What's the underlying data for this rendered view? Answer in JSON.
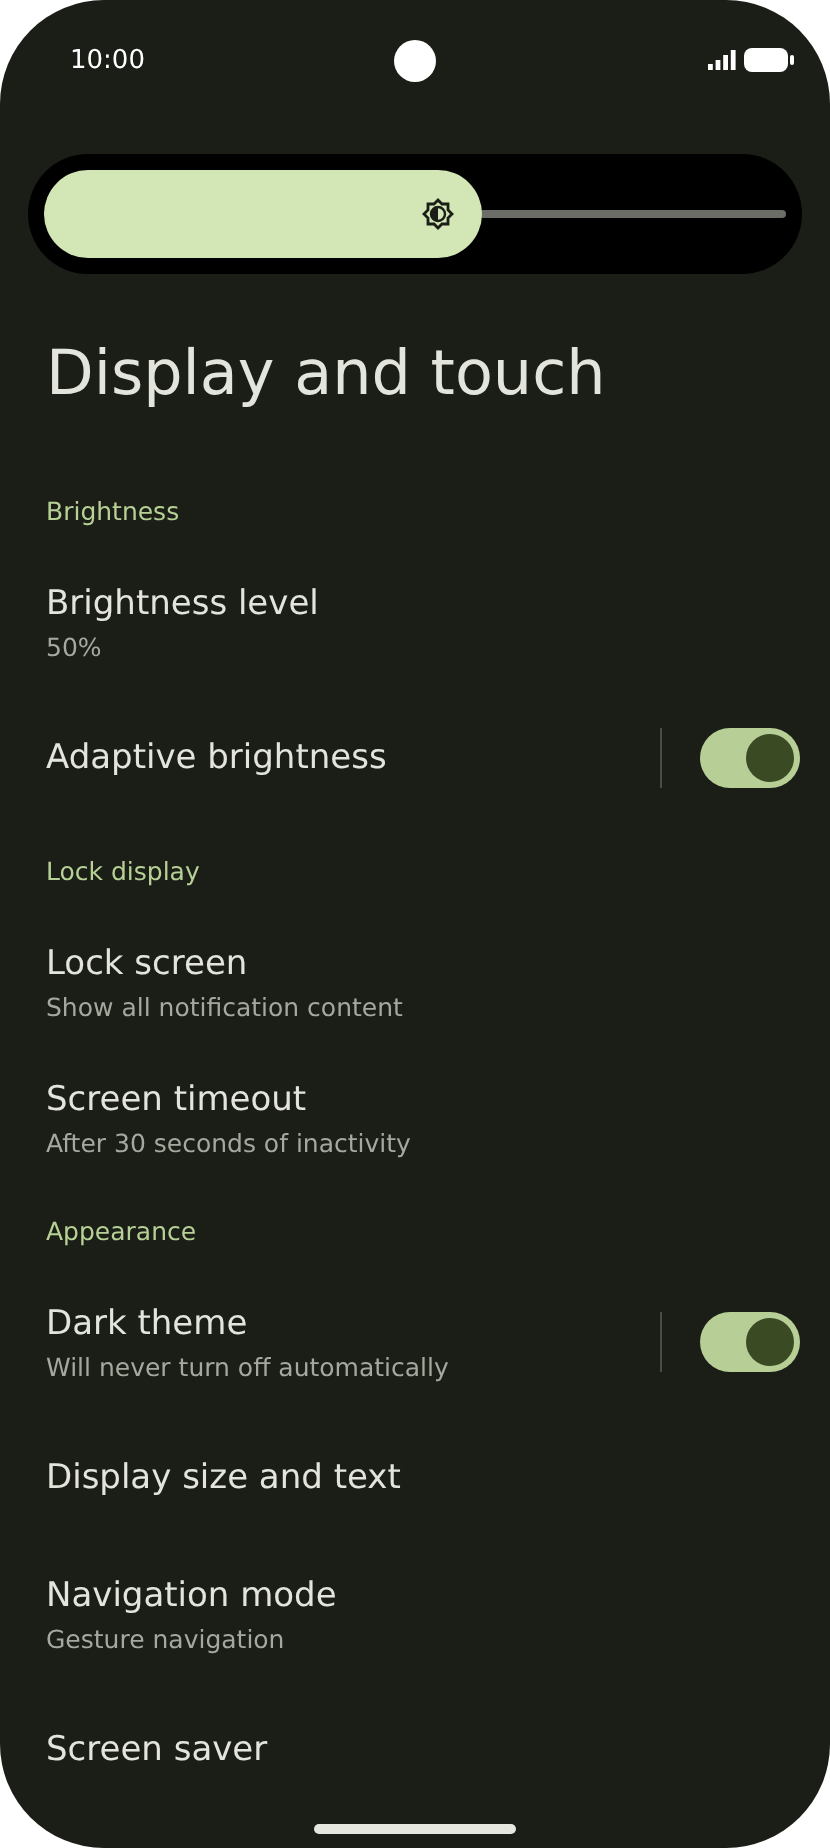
{
  "status_bar": {
    "time": "10:00"
  },
  "brightness_slider": {
    "level": 0.59
  },
  "title": "Display and touch",
  "list": [
    {
      "kind": "header",
      "label": "Brightness"
    },
    {
      "kind": "item",
      "title": "Brightness level",
      "subtitle": "50%"
    },
    {
      "kind": "toggle",
      "title": "Adaptive brightness",
      "on": true
    },
    {
      "kind": "header",
      "label": "Lock display"
    },
    {
      "kind": "item",
      "title": "Lock screen",
      "subtitle": "Show all notification content"
    },
    {
      "kind": "item",
      "title": "Screen timeout",
      "subtitle": "After 30 seconds of inactivity"
    },
    {
      "kind": "header",
      "label": "Appearance"
    },
    {
      "kind": "toggle",
      "title": "Dark theme",
      "subtitle": "Will never turn off automatically",
      "on": true
    },
    {
      "kind": "item",
      "title": "Display size and text"
    },
    {
      "kind": "item",
      "title": "Navigation mode",
      "subtitle": "Gesture navigation"
    },
    {
      "kind": "item",
      "title": "Screen saver"
    }
  ]
}
